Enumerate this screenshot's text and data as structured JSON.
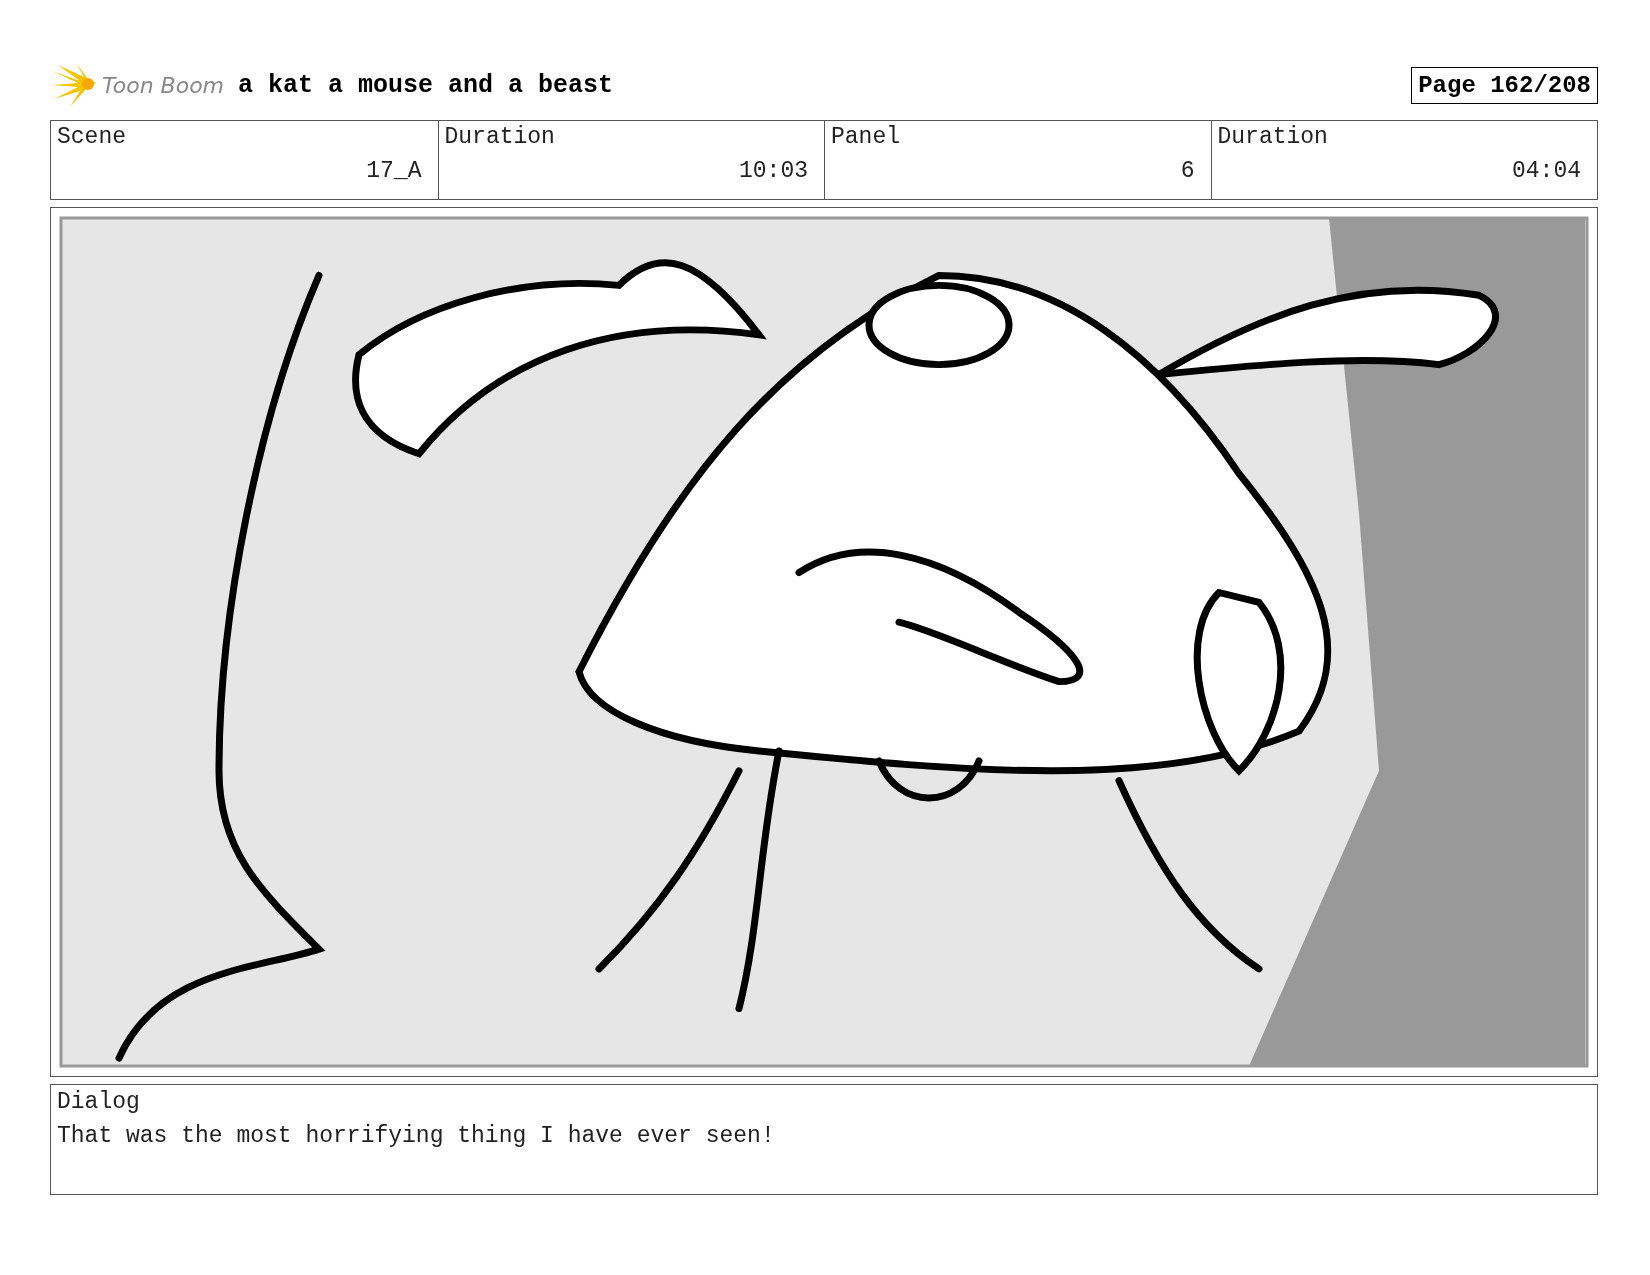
{
  "header": {
    "logo_text": "Toon Boom",
    "title": "a kat a mouse and a beast",
    "page": "Page 162/208"
  },
  "info": [
    {
      "label": "Scene",
      "value": "17_A"
    },
    {
      "label": "Duration",
      "value": "10:03"
    },
    {
      "label": "Panel",
      "value": "6"
    },
    {
      "label": "Duration",
      "value": "04:04"
    }
  ],
  "dialog": {
    "label": "Dialog",
    "text": "That was the most horrifying thing I have ever seen!"
  }
}
